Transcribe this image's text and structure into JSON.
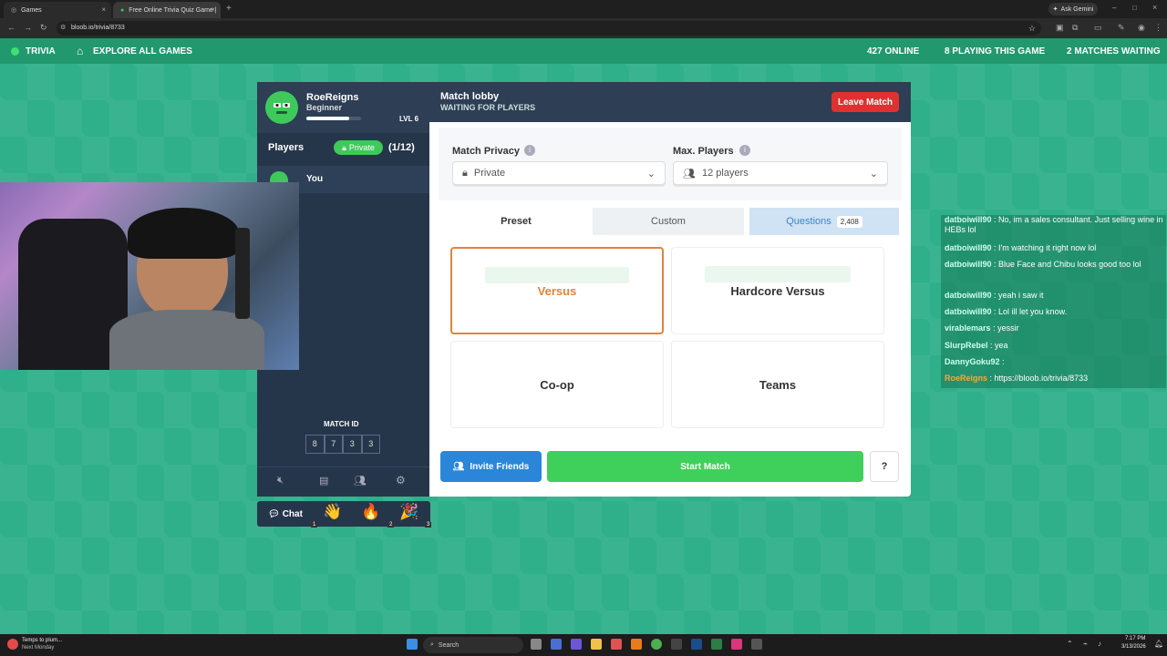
{
  "browser": {
    "tabs": [
      {
        "label": "Games"
      },
      {
        "label": "Free Online Trivia Quiz Game |"
      }
    ],
    "url": "bloob.io/trivia/8733",
    "ask_label": "Ask Gemini"
  },
  "appbar": {
    "brand": "TRIVIA",
    "explore": "EXPLORE ALL GAMES",
    "online": "427 ONLINE",
    "playing": "8 PLAYING THIS GAME",
    "waiting": "2 MATCHES WAITING"
  },
  "profile": {
    "name": "RoeReigns",
    "rank": "Beginner",
    "level": "LVL 6",
    "xp_fraction": 0.78
  },
  "players": {
    "heading": "Players",
    "privacy_badge": "Private",
    "count": "(1/12)",
    "list": [
      {
        "name": "You"
      }
    ]
  },
  "match_id": {
    "label": "MATCH ID",
    "digits": [
      "8",
      "7",
      "3",
      "3"
    ]
  },
  "lobby": {
    "title": "Match lobby",
    "subtitle": "WAITING FOR PLAYERS",
    "leave_label": "Leave Match",
    "privacy_label": "Match Privacy",
    "privacy_value": "Private",
    "max_label": "Max. Players",
    "max_value": "12 players",
    "tabs": {
      "preset": "Preset",
      "custom": "Custom",
      "questions": "Questions",
      "questions_count": "2,408"
    },
    "modes": [
      {
        "label": "Versus"
      },
      {
        "label": "Hardcore Versus"
      },
      {
        "label": "Co-op"
      },
      {
        "label": "Teams"
      }
    ],
    "invite_label": "Invite Friends",
    "start_label": "Start Match",
    "help_label": "?"
  },
  "chatbar": {
    "chat_label": "Chat",
    "reactions": [
      {
        "emoji": "👋",
        "count": "1"
      },
      {
        "emoji": "🔥",
        "count": "2"
      },
      {
        "emoji": "🎉",
        "count": "3"
      }
    ]
  },
  "overlay_chat": [
    {
      "user": "datboiwill90",
      "text": ": No, im a sales consultant. Just selling wine in HEBs lol"
    },
    {
      "user": "datboiwill90",
      "text": ": I'm watching it right now lol"
    },
    {
      "user": "datboiwill90",
      "text": ": Blue Face and Chibu looks good too lol"
    },
    {
      "user": "datboiwill90",
      "text": ": yeah i saw it"
    },
    {
      "user": "datboiwill90",
      "text": ": Lol ill let you know."
    },
    {
      "user": "virablemars",
      "text": ": yessir"
    },
    {
      "user": "SlurpRebel",
      "text": ": yea"
    },
    {
      "user": "DannyGoku92",
      "text": ":"
    },
    {
      "user": "RoeReigns",
      "text": ": https://bloob.io/trivia/8733"
    }
  ],
  "taskbar": {
    "weather_title": "Temps to plum...",
    "weather_sub": "Next Monday",
    "search": "Search",
    "time": "7:17 PM",
    "date": "3/13/2026"
  },
  "colors": {
    "accent_green": "#3ec95a",
    "leave_red": "#e03131",
    "invite_blue": "#2b86d9",
    "start_green": "#3fd05b",
    "selected_orange": "#e0843a"
  }
}
